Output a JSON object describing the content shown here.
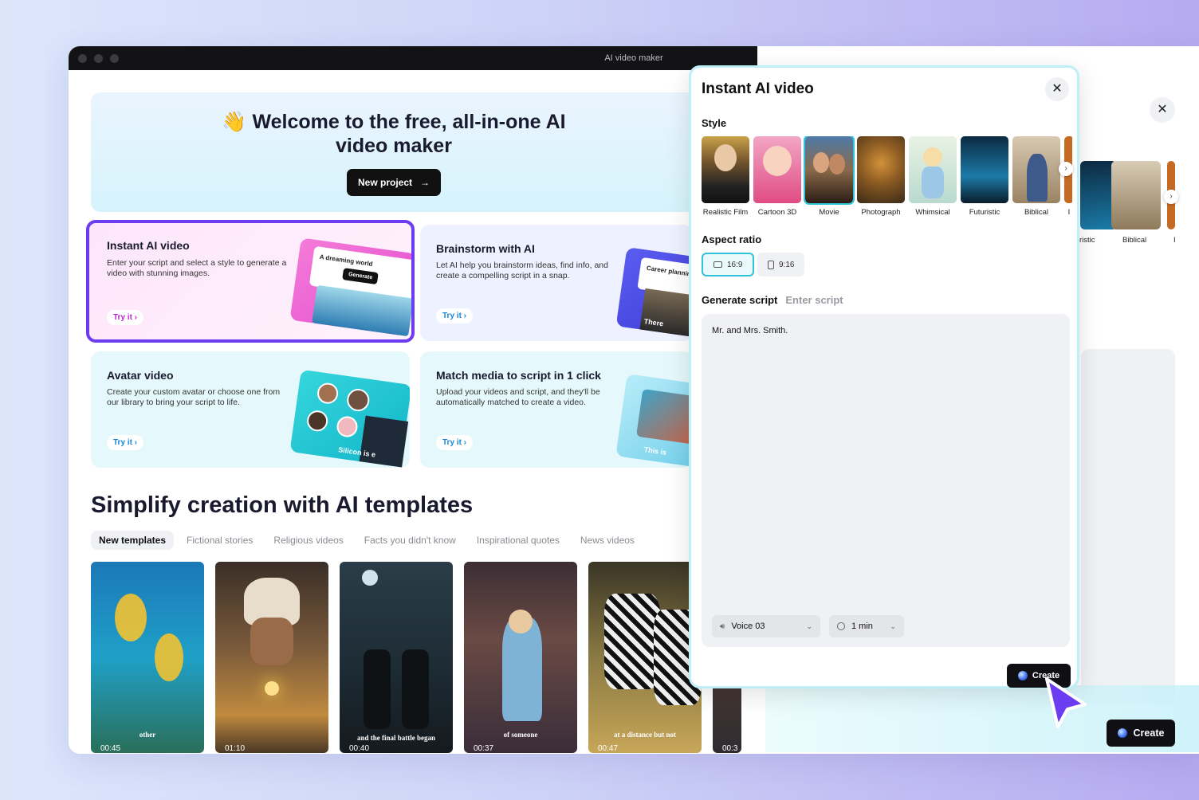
{
  "window": {
    "title": "AI video maker"
  },
  "hero": {
    "emoji": "👋",
    "title_line1": "Welcome to the free, all-in-one AI",
    "title_line2": "video maker",
    "new_project": "New project"
  },
  "features": [
    {
      "title": "Instant AI video",
      "desc": "Enter your script and select a style to generate a video with stunning images.",
      "cta": "Try it",
      "illu_text": "A dreaming world",
      "illu_btn": "Generate"
    },
    {
      "title": "Brainstorm with AI",
      "desc": "Let AI help you brainstorm ideas, find info, and create a compelling script in a snap.",
      "cta": "Try it",
      "illu_text": "Career planning",
      "illu_text2": "There"
    },
    {
      "title": "Avatar video",
      "desc": "Create your custom avatar or choose one from our library to bring your script to life.",
      "cta": "Try it",
      "illu_text": "Silicon is e"
    },
    {
      "title": "Match media to script in 1 click",
      "desc": "Upload your videos and script, and they'll be automatically matched to create a video.",
      "cta": "Try it",
      "illu_text": "This is"
    }
  ],
  "templates": {
    "title": "Simplify creation with AI templates",
    "tabs": [
      "New templates",
      "Fictional stories",
      "Religious videos",
      "Facts you didn't know",
      "Inspirational quotes",
      "News videos"
    ],
    "items": [
      {
        "caption": "other",
        "duration": "00:45"
      },
      {
        "caption": "",
        "duration": "01:10"
      },
      {
        "caption": "and the final battle began",
        "duration": "00:40"
      },
      {
        "caption": "of someone",
        "duration": "00:37"
      },
      {
        "caption": "at a distance but not",
        "duration": "00:47"
      },
      {
        "caption": "",
        "duration": "00:3"
      }
    ]
  },
  "background_panel": {
    "styles": [
      "ristic",
      "Biblical",
      "I"
    ],
    "create": "Create"
  },
  "modal": {
    "title": "Instant AI video",
    "style_label": "Style",
    "styles": [
      {
        "name": "Realistic Film",
        "selected": false
      },
      {
        "name": "Cartoon 3D",
        "selected": false
      },
      {
        "name": "Movie",
        "selected": true
      },
      {
        "name": "Photograph",
        "selected": false
      },
      {
        "name": "Whimsical",
        "selected": false
      },
      {
        "name": "Futuristic",
        "selected": false
      },
      {
        "name": "Biblical",
        "selected": false
      },
      {
        "name": "I",
        "selected": false
      }
    ],
    "aspect_label": "Aspect ratio",
    "aspect": [
      {
        "label": "16:9",
        "selected": true
      },
      {
        "label": "9:16",
        "selected": false
      }
    ],
    "script_tab_active": "Generate script",
    "script_tab_inactive": "Enter script",
    "script_text": "Mr. and Mrs. Smith.",
    "voice": "Voice 03",
    "duration": "1 min",
    "create": "Create"
  },
  "colors": {
    "accent": "#2ec4dc",
    "highlight": "#6b3cf0",
    "cta_purple": "#c026d3",
    "cta_blue": "#1787d6"
  }
}
